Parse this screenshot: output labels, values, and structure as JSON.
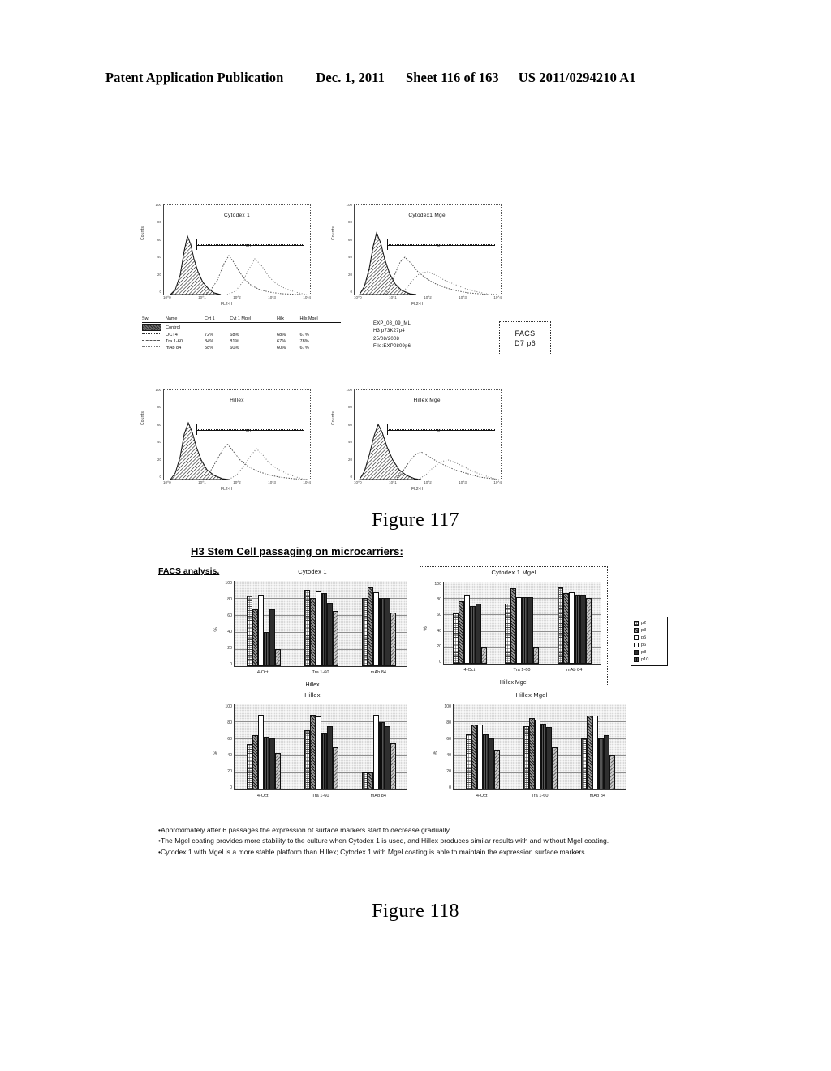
{
  "header": {
    "title": "Patent Application Publication",
    "date": "Dec. 1, 2011",
    "sheet": "Sheet 116 of 163",
    "doc_number": "US 2011/0294210 A1"
  },
  "figure117": {
    "caption": "Figure 117",
    "panels": [
      {
        "title": "Cytodex 1",
        "gate_label": "M1",
        "ylabel": "Counts",
        "xlabel": "FL2-H",
        "yticks": [
          "100",
          "80",
          "60",
          "40",
          "20",
          "0"
        ],
        "xticks": [
          "10^0",
          "10^1",
          "10^2",
          "10^3",
          "10^4"
        ]
      },
      {
        "title": "Cytodex1 Mgel",
        "gate_label": "M1",
        "ylabel": "Counts",
        "xlabel": "FL2-H",
        "yticks": [
          "100",
          "80",
          "60",
          "40",
          "20",
          "0"
        ],
        "xticks": [
          "10^0",
          "10^1",
          "10^2",
          "10^3",
          "10^4"
        ]
      },
      {
        "title": "Hillex",
        "gate_label": "M1",
        "ylabel": "Counts",
        "xlabel": "FL2-H",
        "yticks": [
          "100",
          "80",
          "60",
          "40",
          "20",
          "0"
        ],
        "xticks": [
          "10^0",
          "10^1",
          "10^2",
          "10^3",
          "10^4"
        ]
      },
      {
        "title": "Hillex Mgel",
        "gate_label": "M1",
        "ylabel": "Counts",
        "xlabel": "FL2-H",
        "yticks": [
          "100",
          "80",
          "60",
          "40",
          "20",
          "0"
        ],
        "xticks": [
          "10^0",
          "10^1",
          "10^2",
          "10^3",
          "10^4"
        ]
      }
    ],
    "legend_table": {
      "columns": [
        "Sw.",
        "Name",
        "Cyt 1",
        "Cyt 1 Mgel",
        "Hilx",
        "Hilx Mgel"
      ],
      "rows": [
        {
          "swatch": "filled",
          "name": "Control",
          "cyt1": "",
          "cyt1_mgel": "",
          "hilx": "",
          "hilx_mgel": ""
        },
        {
          "swatch": "dot1",
          "name": "OCT4",
          "cyt1": "72%",
          "cyt1_mgel": "68%",
          "hilx": "68%",
          "hilx_mgel": "67%"
        },
        {
          "swatch": "dot2",
          "name": "Tra 1-60",
          "cyt1": "84%",
          "cyt1_mgel": "81%",
          "hilx": "67%",
          "hilx_mgel": "78%"
        },
        {
          "swatch": "dot3",
          "name": "mAb 84",
          "cyt1": "58%",
          "cyt1_mgel": "60%",
          "hilx": "60%",
          "hilx_mgel": "67%"
        }
      ]
    },
    "run_info": [
      "EXP_08_09_ML",
      "H3 p73K27p4",
      "25/08/2008",
      "File:EXP0809p6"
    ],
    "facs_box": {
      "line1": "FACS",
      "line2": "D7 p6"
    }
  },
  "figure118": {
    "caption": "Figure 118",
    "title": "H3 Stem Cell passaging on microcarriers:",
    "subtitle": "FACS analysis.",
    "legend": [
      {
        "label": "p2",
        "color": "#4a4a4a"
      },
      {
        "label": "p3",
        "color": "#2f2f2f"
      },
      {
        "label": "p5",
        "color": "#ffffff"
      },
      {
        "label": "p6",
        "color": "#ffffff"
      },
      {
        "label": "p8",
        "color": "#2f2f2f"
      },
      {
        "label": "p10",
        "color": "#555555"
      }
    ],
    "notes": [
      "•Approximately after 6 passages the expression of surface markers start  to decrease gradually.",
      "•The Mgel coating provides more stability to the culture when Cytodex 1 is used, and Hillex produces similar results with and without Mgel coating.",
      "•Cytodex 1 with Mgel is a more stable platform than Hillex; Cytodex 1 with Mgel coating is able to maintain the expression surface markers."
    ]
  },
  "chart_data": [
    {
      "type": "bar",
      "title": "Cytodex 1",
      "xlabel": "Hillex",
      "ylabel": "%",
      "ylim": [
        0,
        100
      ],
      "yticks": [
        0,
        20,
        40,
        60,
        80,
        100
      ],
      "grid": true,
      "legend_position": "right",
      "categories": [
        "4-Oct",
        "Tra 1-60",
        "mAb 84"
      ],
      "series": [
        {
          "name": "p2",
          "values": [
            83,
            90,
            80
          ]
        },
        {
          "name": "p3",
          "values": [
            67,
            80,
            92
          ]
        },
        {
          "name": "p5",
          "values": [
            84,
            88,
            87
          ]
        },
        {
          "name": "p6",
          "values": [
            40,
            86,
            80
          ]
        },
        {
          "name": "p8",
          "values": [
            67,
            74,
            80
          ]
        },
        {
          "name": "p10",
          "values": [
            20,
            65,
            63
          ]
        }
      ]
    },
    {
      "type": "bar",
      "title": "Cytodex 1 Mgel",
      "xlabel": "Hillex Mgel",
      "ylabel": "%",
      "ylim": [
        0,
        100
      ],
      "yticks": [
        0,
        20,
        40,
        60,
        80,
        100
      ],
      "grid": true,
      "legend_position": "right",
      "categories": [
        "4-Oct",
        "Tra 1-60",
        "mAb 84"
      ],
      "series": [
        {
          "name": "p2",
          "values": [
            61,
            73,
            93
          ]
        },
        {
          "name": "p3",
          "values": [
            76,
            92,
            86
          ]
        },
        {
          "name": "p5",
          "values": [
            84,
            81,
            87
          ]
        },
        {
          "name": "p6",
          "values": [
            70,
            81,
            84
          ]
        },
        {
          "name": "p8",
          "values": [
            73,
            81,
            84
          ]
        },
        {
          "name": "p10",
          "values": [
            20,
            20,
            80
          ]
        }
      ]
    },
    {
      "type": "bar",
      "title": "Hillex",
      "xlabel": "",
      "ylabel": "%",
      "ylim": [
        0,
        100
      ],
      "yticks": [
        0,
        20,
        40,
        60,
        80,
        100
      ],
      "grid": true,
      "legend_position": "right",
      "categories": [
        "4-Oct",
        "Tra 1-60",
        "mAb 84"
      ],
      "series": [
        {
          "name": "p2",
          "values": [
            53,
            70,
            20
          ]
        },
        {
          "name": "p3",
          "values": [
            64,
            88,
            20
          ]
        },
        {
          "name": "p5",
          "values": [
            88,
            86,
            88
          ]
        },
        {
          "name": "p6",
          "values": [
            62,
            66,
            79
          ]
        },
        {
          "name": "p8",
          "values": [
            60,
            74,
            74
          ]
        },
        {
          "name": "p10",
          "values": [
            43,
            50,
            54
          ]
        }
      ]
    },
    {
      "type": "bar",
      "title": "Hillex Mgel",
      "xlabel": "",
      "ylabel": "%",
      "ylim": [
        0,
        100
      ],
      "yticks": [
        0,
        20,
        40,
        60,
        80,
        100
      ],
      "grid": true,
      "legend_position": "right",
      "categories": [
        "4-Oct",
        "Tra 1-60",
        "mAb 84"
      ],
      "series": [
        {
          "name": "p2",
          "values": [
            65,
            74,
            60
          ]
        },
        {
          "name": "p3",
          "values": [
            76,
            84,
            87
          ]
        },
        {
          "name": "p5",
          "values": [
            76,
            82,
            87
          ]
        },
        {
          "name": "p6",
          "values": [
            65,
            77,
            60
          ]
        },
        {
          "name": "p8",
          "values": [
            60,
            73,
            64
          ]
        },
        {
          "name": "p10",
          "values": [
            47,
            50,
            40
          ]
        }
      ]
    }
  ]
}
